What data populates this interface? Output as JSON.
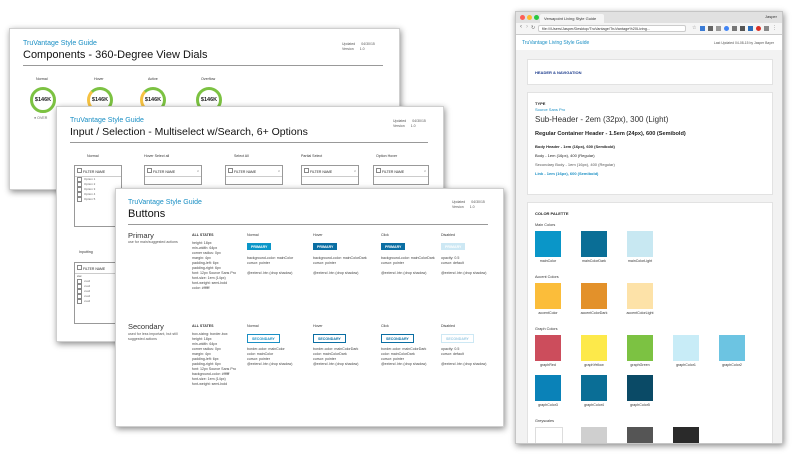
{
  "brand": "TruVantage Style Guide",
  "sheet1": {
    "title": "Components - 360-Degree View Dials",
    "meta_labels": [
      "Updated",
      "Version"
    ],
    "meta_values": [
      "04/30/15",
      "1.0"
    ],
    "columns": [
      "Normal",
      "Hover",
      "Active",
      "Overflow"
    ],
    "dial_values": [
      "$146K",
      "$146K",
      "$146K",
      "$146K"
    ],
    "dial_caption": "OVER"
  },
  "sheet2": {
    "title": "Input / Selection - Multiselect w/Search, 6+ Options",
    "meta_labels": [
      "Updated",
      "Version"
    ],
    "meta_values": [
      "04/30/15",
      "1.0"
    ],
    "columns": [
      "Normal",
      "Hover Select all",
      "Select All",
      "Partial Select",
      "Option Hover"
    ],
    "filter_name": "FILTER NAME",
    "options": [
      "Option 1",
      "Option 2",
      "Option 3",
      "Option 4",
      "Option 5"
    ],
    "inputting_label": "Inputting",
    "input_text": "xxx",
    "input_results": [
      "xxxd",
      "xxxd",
      "xxxd",
      "xxxd",
      "xxxd"
    ]
  },
  "sheet3": {
    "title": "Buttons",
    "meta_labels": [
      "Updated",
      "Version"
    ],
    "meta_values": [
      "04/30/15",
      "1.0"
    ],
    "primary": {
      "name": "Primary",
      "desc": "use for main/suggested actions",
      "all_states_label": "ALL STATES",
      "all_states": [
        "height: 18px",
        "min-width: 64px",
        "corner radius: 0px",
        "margin: 4px",
        "padding-left: 6px",
        "padding-right: 6px",
        "font: 12px Source Sans Pro",
        "font-size: 1em (14px)",
        "font-weight: semi-bold",
        "color: #ffffff"
      ],
      "states": [
        "Normal",
        "Hover",
        "Click",
        "Disabled"
      ],
      "button_label": "PRIMARY",
      "state_notes": [
        [
          "background-color: mainColor",
          "cursor: pointer",
          "",
          "@extend .btn (drop shadow)"
        ],
        [
          "background-color: mainColorDark",
          "cursor: pointer",
          "",
          "@extend .btn (drop shadow)"
        ],
        [
          "background-color: mainColorDark",
          "cursor: pointer",
          "",
          "@extend .btn (drop shadow)"
        ],
        [
          "opacity: 0.5",
          "cursor: default",
          "",
          "@extend .btn (drop shadow)"
        ]
      ]
    },
    "secondary": {
      "name": "Secondary",
      "desc": "used for less important, but still suggested actions",
      "all_states_label": "ALL STATES",
      "all_states": [
        "box-sizing: border-box",
        "height: 18px",
        "min-width: 64px",
        "corner radius: 0px",
        "margin: 4px",
        "padding-left: 6px",
        "padding-right: 6px",
        "font: 12px Source Sans Pro",
        "background-color: #ffffff",
        "font-size: 1em (14px)",
        "font-weight: semi-bold"
      ],
      "states": [
        "Normal",
        "Hover",
        "Click",
        "Disabled"
      ],
      "button_label": "SECONDARY",
      "state_notes": [
        [
          "border-color: mainColor",
          "color: mainColor",
          "cursor: pointer",
          "@extend .btn (drop shadow)"
        ],
        [
          "border-color: mainColorDark",
          "color: mainColorDark",
          "cursor: pointer",
          "@extend .btn (drop shadow)"
        ],
        [
          "border-color: mainColorDark",
          "color: mainColorDark",
          "cursor: pointer",
          "@extend .btn (drop shadow)"
        ],
        [
          "opacity: 0.5",
          "cursor: default",
          "",
          "@extend .btn (drop shadow)"
        ]
      ]
    }
  },
  "browser": {
    "tab_title": "Versapoint Living Style Guide",
    "url": "file:///Users/Jasper/Desktop/TruVantage/TruVantage%20Living...",
    "user": "Jasper",
    "header_brand": "TruVantage Living Style Guide",
    "last_updated": "Last Updated 04-08-15 by Jasper Bayer",
    "nav_heading": "HEADER & NAVIGATION",
    "type": {
      "heading": "TYPE",
      "font_name": "Source Sans Pro",
      "subheader": "Sub-Header - 2em (32px), 300 (Light)",
      "regular_header": "Regular Container Header - 1.5em (24px), 600 (Semibold)",
      "body_header": "Body Header - 1em (16px), 600 (Semibold)",
      "body": "Body - 1em (16px), 400 (Regular)",
      "secondary_body": "Secondary Body - 1em (16px), 400 (Regular)",
      "link": "Link - 1em (16px), 600 (Semibold)"
    },
    "palette": {
      "heading": "COLOR PALETTE",
      "groups": [
        {
          "label": "Main Colors",
          "swatches": [
            {
              "name": "mainColor",
              "color": "#0a96c8"
            },
            {
              "name": "mainColorDark",
              "color": "#0a6e96"
            },
            {
              "name": "mainColorLight",
              "color": "#c8e8f2"
            }
          ]
        },
        {
          "label": "Accent Colors",
          "swatches": [
            {
              "name": "accentColor",
              "color": "#fbbd3a"
            },
            {
              "name": "accentColorDark",
              "color": "#e3912a"
            },
            {
              "name": "accentColorLight",
              "color": "#fde2a8"
            }
          ]
        },
        {
          "label": "Graph Colors",
          "swatches": [
            {
              "name": "graphRed",
              "color": "#cc4d5c"
            },
            {
              "name": "graphYellow",
              "color": "#fde94a"
            },
            {
              "name": "graphGreen",
              "color": "#7cc242"
            },
            {
              "name": "graphColor1",
              "color": "#c8ecf7"
            },
            {
              "name": "graphColor2",
              "color": "#6cc4e2"
            },
            {
              "name": "graphColor3",
              "color": "#0a82b8"
            },
            {
              "name": "graphColor4",
              "color": "#0a6e96"
            },
            {
              "name": "graphColor5",
              "color": "#0a4a66"
            }
          ]
        },
        {
          "label": "Greyscales",
          "swatches": [
            {
              "name": "",
              "color": "#ffffff"
            },
            {
              "name": "",
              "color": "#cfcfcf"
            },
            {
              "name": "",
              "color": "#555555"
            },
            {
              "name": "",
              "color": "#2a2a2a"
            }
          ]
        }
      ]
    }
  }
}
